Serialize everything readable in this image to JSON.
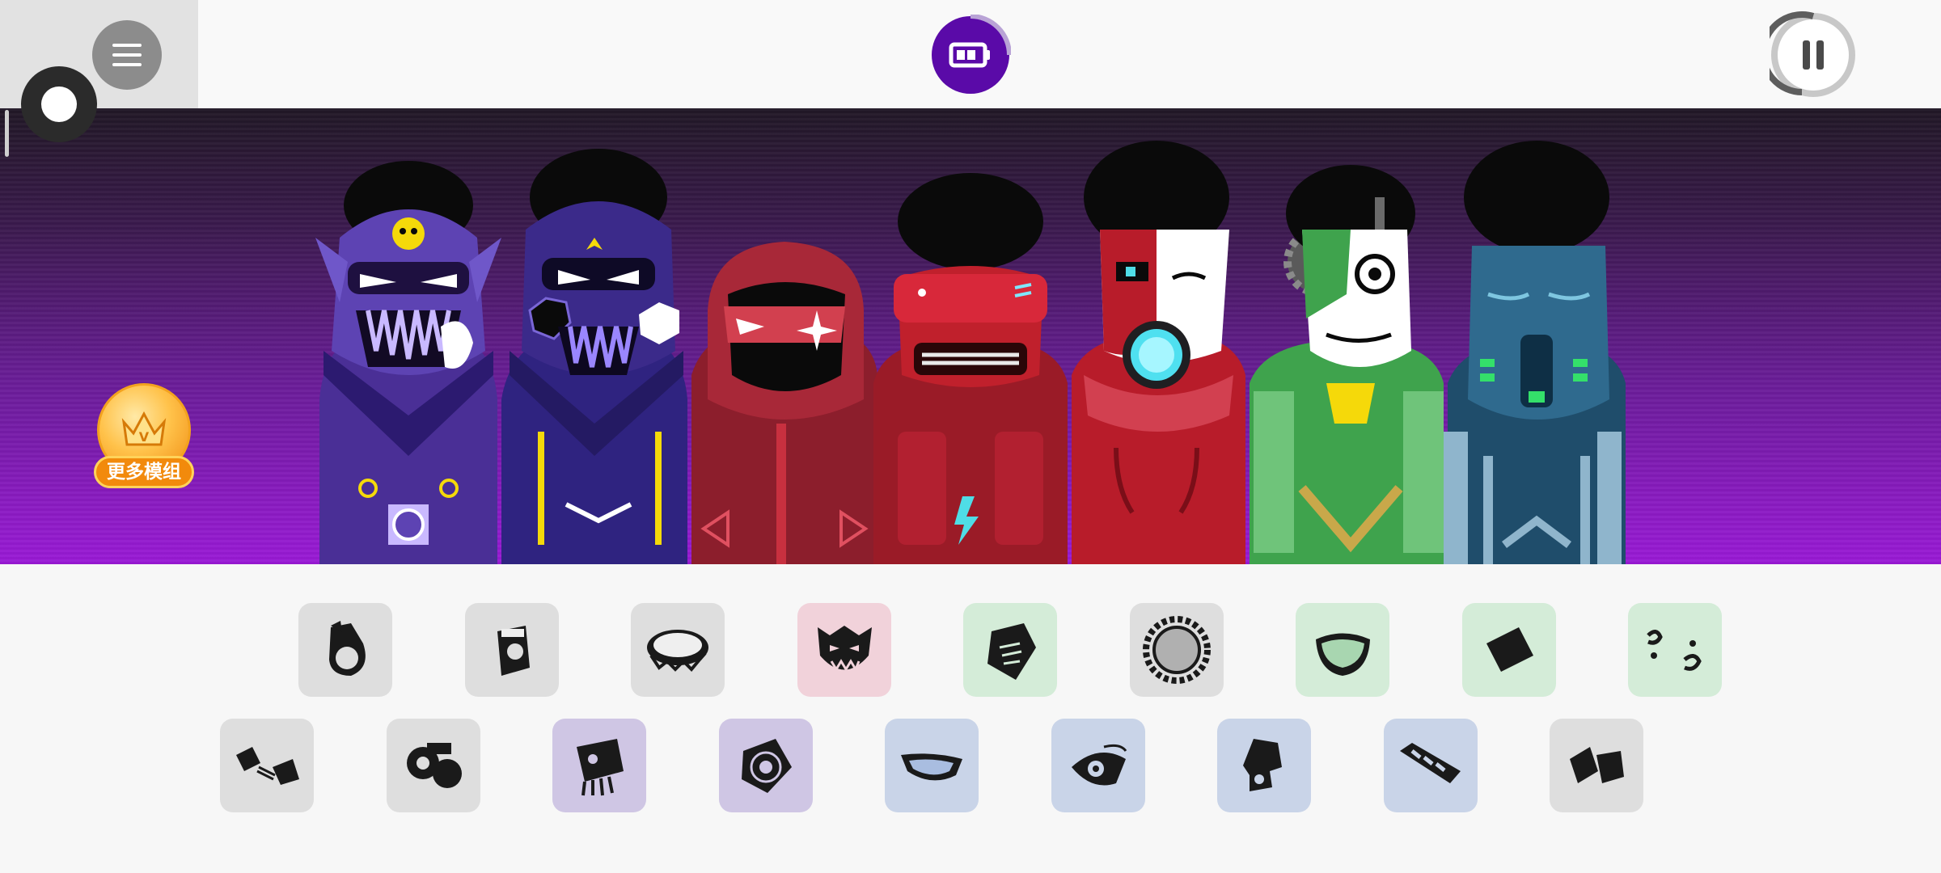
{
  "header": {
    "menu_icon": "hamburger-menu-icon",
    "record_icon": "record-circle-icon",
    "center_icon": "battery-icon",
    "center_color": "#5a0aa8",
    "pause_icon": "pause-icon"
  },
  "promo": {
    "label": "更多模组",
    "icon": "crown-medal-icon",
    "badge_letter": "V",
    "color": "#f28a0c"
  },
  "characters": [
    {
      "name": "purple-skull-ninja",
      "color": "#5b3fa8"
    },
    {
      "name": "indigo-hex-mask",
      "color": "#3b2a8a"
    },
    {
      "name": "red-hooded-star",
      "color": "#a82838"
    },
    {
      "name": "red-visor-robot",
      "color": "#c0202c"
    },
    {
      "name": "red-cyborg-orb",
      "color": "#b81c2a"
    },
    {
      "name": "green-mime-gear",
      "color": "#3fa34d"
    },
    {
      "name": "teal-gasmask",
      "color": "#2e5a78"
    }
  ],
  "sound_icons": {
    "row1": [
      {
        "icon": "hook-beat-icon",
        "category": "beat"
      },
      {
        "icon": "cup-beat-icon",
        "category": "beat"
      },
      {
        "icon": "drum-beat-icon",
        "category": "beat"
      },
      {
        "icon": "demon-effect-icon",
        "category": "effect"
      },
      {
        "icon": "gem-melody-icon",
        "category": "melody"
      },
      {
        "icon": "sun-melody-icon",
        "category": "beat"
      },
      {
        "icon": "bowl-melody-icon",
        "category": "melody"
      },
      {
        "icon": "tile-melody-icon",
        "category": "melody"
      },
      {
        "icon": "swirl-melody-icon",
        "category": "melody"
      }
    ],
    "row2": [
      {
        "icon": "bolt-beat-icon",
        "category": "beat"
      },
      {
        "icon": "gear-beat-icon",
        "category": "beat"
      },
      {
        "icon": "squid-effect-icon",
        "category": "effect"
      },
      {
        "icon": "vortex-effect-icon",
        "category": "effect"
      },
      {
        "icon": "boat-voice-icon",
        "category": "voice"
      },
      {
        "icon": "eye-voice-icon",
        "category": "voice"
      },
      {
        "icon": "bell-voice-icon",
        "category": "voice"
      },
      {
        "icon": "chain-voice-icon",
        "category": "voice"
      },
      {
        "icon": "fold-beat-icon",
        "category": "beat"
      }
    ]
  },
  "category_colors": {
    "beat": "#dedede",
    "effect_pink": "#f1d2da",
    "melody": "#d4ecd8",
    "effect": "#cfc6e4",
    "voice": "#c9d4e8"
  }
}
